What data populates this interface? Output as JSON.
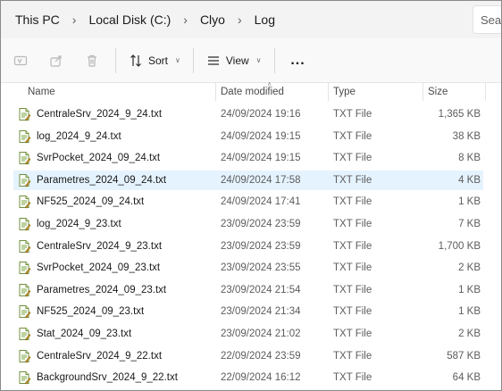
{
  "breadcrumb": [
    "This PC",
    "Local Disk (C:)",
    "Clyo",
    "Log"
  ],
  "search": {
    "placeholder": "Search"
  },
  "toolbar": {
    "sort_label": "Sort",
    "view_label": "View",
    "more_label": "..."
  },
  "columns": {
    "name": "Name",
    "date": "Date modified",
    "type": "Type",
    "size": "Size"
  },
  "files": [
    {
      "name": "CentraleSrv_2024_9_24.txt",
      "date": "24/09/2024 19:16",
      "type": "TXT File",
      "size": "1,365 KB",
      "selected": false
    },
    {
      "name": "log_2024_9_24.txt",
      "date": "24/09/2024 19:15",
      "type": "TXT File",
      "size": "38 KB",
      "selected": false
    },
    {
      "name": "SvrPocket_2024_09_24.txt",
      "date": "24/09/2024 19:15",
      "type": "TXT File",
      "size": "8 KB",
      "selected": false
    },
    {
      "name": "Parametres_2024_09_24.txt",
      "date": "24/09/2024 17:58",
      "type": "TXT File",
      "size": "4 KB",
      "selected": true
    },
    {
      "name": "NF525_2024_09_24.txt",
      "date": "24/09/2024 17:41",
      "type": "TXT File",
      "size": "1 KB",
      "selected": false
    },
    {
      "name": "log_2024_9_23.txt",
      "date": "23/09/2024 23:59",
      "type": "TXT File",
      "size": "7 KB",
      "selected": false
    },
    {
      "name": "CentraleSrv_2024_9_23.txt",
      "date": "23/09/2024 23:59",
      "type": "TXT File",
      "size": "1,700 KB",
      "selected": false
    },
    {
      "name": "SvrPocket_2024_09_23.txt",
      "date": "23/09/2024 23:55",
      "type": "TXT File",
      "size": "2 KB",
      "selected": false
    },
    {
      "name": "Parametres_2024_09_23.txt",
      "date": "23/09/2024 21:54",
      "type": "TXT File",
      "size": "1 KB",
      "selected": false
    },
    {
      "name": "NF525_2024_09_23.txt",
      "date": "23/09/2024 21:34",
      "type": "TXT File",
      "size": "1 KB",
      "selected": false
    },
    {
      "name": "Stat_2024_09_23.txt",
      "date": "23/09/2024 21:02",
      "type": "TXT File",
      "size": "2 KB",
      "selected": false
    },
    {
      "name": "CentraleSrv_2024_9_22.txt",
      "date": "22/09/2024 23:59",
      "type": "TXT File",
      "size": "587 KB",
      "selected": false
    },
    {
      "name": "BackgroundSrv_2024_9_22.txt",
      "date": "22/09/2024 16:12",
      "type": "TXT File",
      "size": "64 KB",
      "selected": false
    }
  ],
  "icons": {
    "toolbar": [
      "rename-icon",
      "share-icon",
      "delete-icon",
      "sort-icon",
      "view-icon"
    ],
    "file": "text-file-icon"
  },
  "colors": {
    "selection": "#e5f3ff",
    "folder_icon": "#7aa43f"
  }
}
